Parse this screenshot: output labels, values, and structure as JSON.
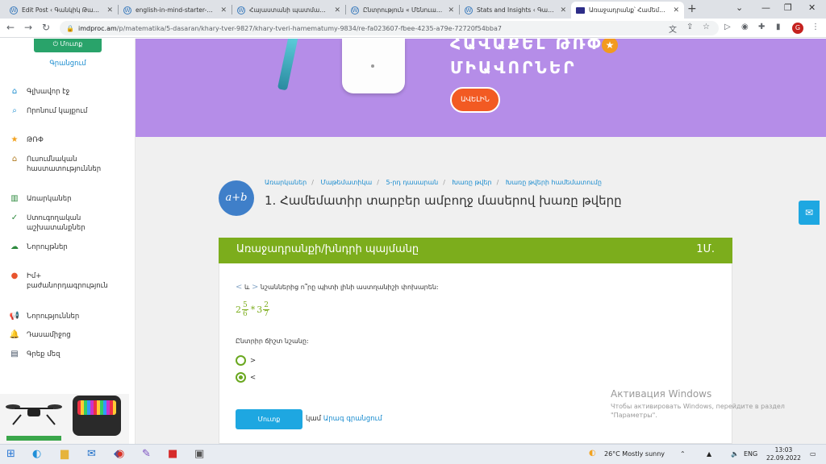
{
  "browser": {
    "tabs": [
      {
        "title": "Edit Post ‹ Գանկիկ Թարգմ..."
      },
      {
        "title": "english-in-mind-starter-1.p..."
      },
      {
        "title": "Հայաստանի պատմավա..."
      },
      {
        "title": "Ընտրություն « Մենուա Հ..."
      },
      {
        "title": "Stats and Insights ‹ Գանկի..."
      },
      {
        "title": "Առաջադրանք՝ Համեմա..."
      }
    ],
    "new_tab": "+",
    "url_host": "imdproc.am",
    "url_path": "/p/matematika/5-dasaran/khary-tver-9827/khary-tveri-hamematumy-9834/re-fa023607-fbee-4235-a79e-72720f54bba7",
    "profile_initial": "G"
  },
  "sidebar": {
    "enter_label": "Մուտք",
    "register_label": "Գրանցում",
    "items": [
      {
        "label": "Գլխավոր էջ",
        "icon": "home-icon"
      },
      {
        "label": "Որոնում կայքում",
        "icon": "search-icon"
      },
      {
        "label": "ԹՌՓ",
        "icon": "star-icon"
      },
      {
        "label": "Ուսումնական հաստատություններ",
        "icon": "institution-icon"
      },
      {
        "label": "Առարկաներ",
        "icon": "books-icon"
      },
      {
        "label": "Ստուգողական աշխատանքներ",
        "icon": "check-circle-icon"
      },
      {
        "label": "Նորույթներ",
        "icon": "cloud-upload-icon"
      },
      {
        "label": "Իմ+ բաժանորդագրություն",
        "icon": "plus-badge-icon"
      },
      {
        "label": "Նորություններ",
        "icon": "megaphone-icon"
      },
      {
        "label": "Դասամիջոց",
        "icon": "bell-icon"
      },
      {
        "label": "Գրեք մեզ",
        "icon": "chat-icon"
      }
    ]
  },
  "banner": {
    "line1": "ՀԱՎԱՔԵԼ ԹՌՓ",
    "line2": "ՄԻԱՎՈՐՆԵՐ",
    "more_label": "ԱՎԵԼԻՆ"
  },
  "lesson": {
    "badge": "a+b",
    "breadcrumbs": [
      "Առարկաներ",
      "Մաթեմատիկա",
      "5-րդ դասարան",
      "Խառը թվեր",
      "Խառը թվերի համեմատումը"
    ],
    "title": "1. Համեմատիր տարբեր ամբողջ մասերով խառը թվերը"
  },
  "task": {
    "header": "Առաջադրանքի/խնդրի պայմանը",
    "points": "1Մ.",
    "sym_lt": "<",
    "conj": "և",
    "sym_gt": ">",
    "question": "նշաններից ո՞րը պիտի լինի աստղանիշի փոխարեն:",
    "expr": {
      "w1": "2",
      "n1": "5",
      "d1": "6",
      "star": "*",
      "w2": "3",
      "n2": "2",
      "d2": "7"
    },
    "choose": "Ընտրիր ճիշտ նշանը:",
    "options": [
      {
        "label": ">",
        "selected": false
      },
      {
        "label": "<",
        "selected": true
      }
    ],
    "submit_label": "Մուտք",
    "or_text": "կամ",
    "quick_register": "Արագ գրանցում"
  },
  "activation": {
    "title": "Активация Windows",
    "line1": "Чтобы активировать Windows, перейдите в раздел",
    "line2": "\"Параметры\"."
  },
  "taskbar": {
    "weather": "26°C  Mostly sunny",
    "lang": "ENG",
    "time": "13:03",
    "date": "22.09.2022"
  },
  "colors": {
    "accent_green": "#7cad1c",
    "brand_blue": "#1ea7e1",
    "banner_purple": "#b58de8"
  }
}
